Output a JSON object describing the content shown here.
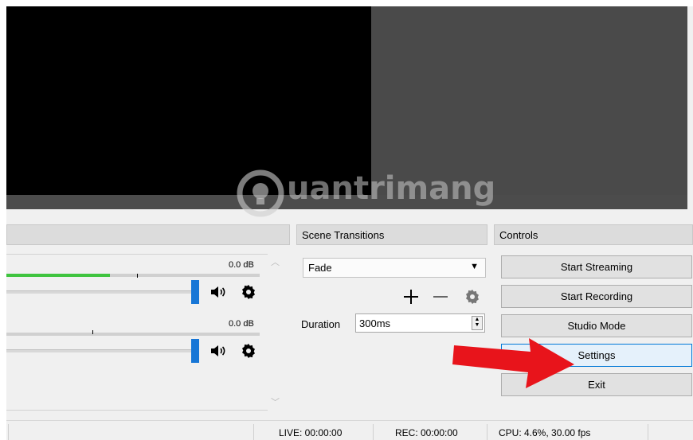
{
  "watermark": {
    "text": "uantrimang"
  },
  "docks": {
    "scene_transitions_title": "Scene Transitions",
    "controls_title": "Controls"
  },
  "mixer": {
    "channels": [
      {
        "db": "0.0 dB",
        "level": 0.41
      },
      {
        "db": "0.0 dB",
        "level": 0.0
      }
    ],
    "speaker_icon": "speaker-icon",
    "gear_icon": "gear-icon"
  },
  "transitions": {
    "selected": "Fade",
    "duration_label": "Duration",
    "duration_value": "300ms"
  },
  "controls": {
    "buttons": [
      "Start Streaming",
      "Start Recording",
      "Studio Mode",
      "Settings",
      "Exit"
    ]
  },
  "status": {
    "live": "LIVE: 00:00:00",
    "rec": "REC: 00:00:00",
    "cpu": "CPU: 4.6%, 30.00 fps"
  },
  "colors": {
    "meter_green": "#3fc43f",
    "slider_blue": "#1776d6",
    "arrow_red": "#e8141b",
    "focus_blue": "#0078d7"
  }
}
